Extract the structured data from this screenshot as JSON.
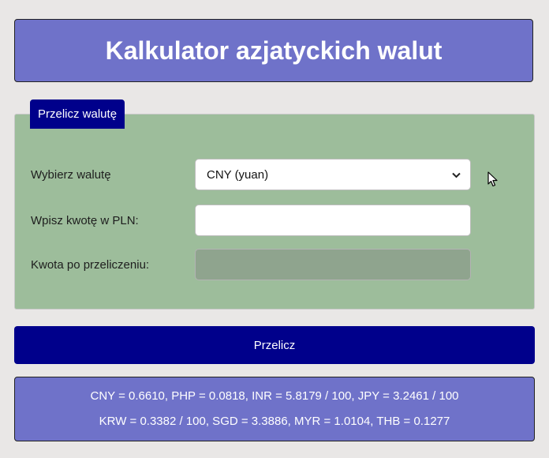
{
  "header": {
    "title": "Kalkulator azjatyckich walut"
  },
  "form": {
    "tab_label": "Przelicz walutę",
    "currency_label": "Wybierz walutę",
    "currency_selected": "CNY (yuan)",
    "amount_label": "Wpisz kwotę w PLN:",
    "amount_value": "",
    "result_label": "Kwota po przeliczeniu:",
    "result_value": ""
  },
  "actions": {
    "convert_label": "Przelicz"
  },
  "rates": {
    "line1": "CNY = 0.6610, PHP = 0.0818, INR = 5.8179 / 100, JPY = 3.2461 / 100",
    "line2": "KRW = 0.3382 / 100, SGD = 3.3886, MYR = 1.0104, THB = 0.1277"
  },
  "icons": {
    "select_arrow": "chevron-down-icon",
    "pointer": "mouse-cursor-icon"
  },
  "colors": {
    "header_bg": "#6f72c9",
    "panel_bg": "#9dbd9b",
    "button_bg": "#00008b",
    "page_bg": "#e9e7e6"
  }
}
